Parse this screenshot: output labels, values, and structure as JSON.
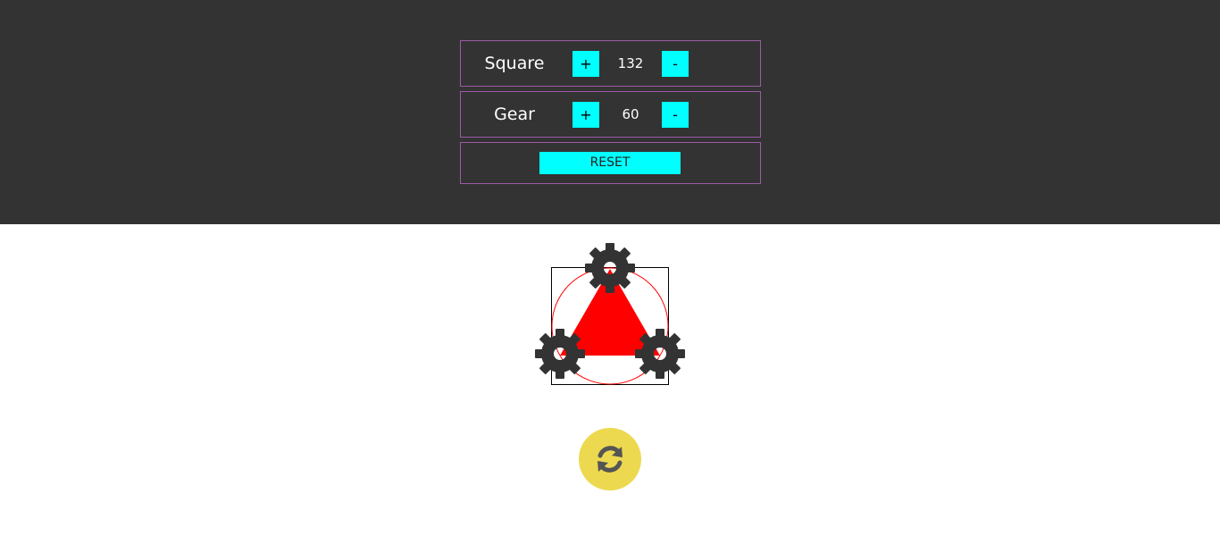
{
  "controls": {
    "square": {
      "label": "Square",
      "value": "132",
      "plus_label": "+",
      "minus_label": "-"
    },
    "gear": {
      "label": "Gear",
      "value": "60",
      "plus_label": "+",
      "minus_label": "-"
    },
    "reset_label": "RESET"
  },
  "colors": {
    "panel_background": "#333333",
    "button_accent": "#00ffff",
    "row_border": "#9c5aa6",
    "triangle": "#ff0000",
    "circle_outline": "#ff0000",
    "gear": "#333333",
    "refresh_background": "#ecd94f",
    "refresh_icon": "#555555"
  },
  "icons": {
    "gear": "gear-icon",
    "refresh": "refresh-icon"
  }
}
